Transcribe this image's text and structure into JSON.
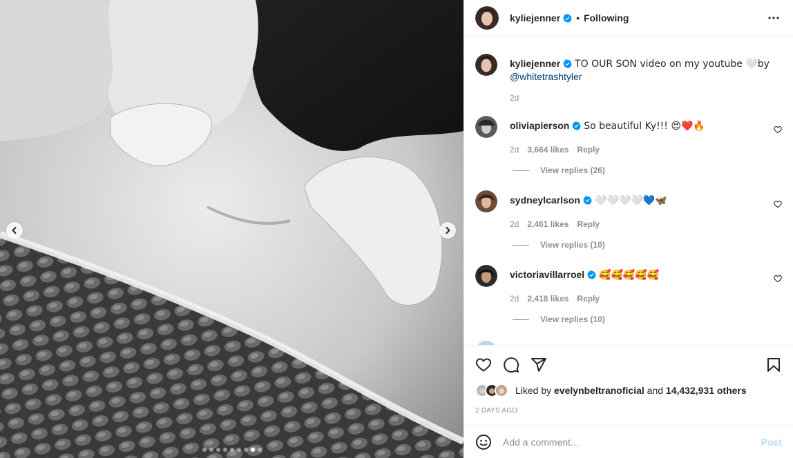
{
  "header": {
    "username": "kyliejenner",
    "separator": "•",
    "following_label": "Following",
    "more_icon": "more-horizontal-icon"
  },
  "caption": {
    "username": "kyliejenner",
    "text": "TO OUR SON video on my youtube 🤍by",
    "mention": "@whitetrashtyler",
    "time": "2d"
  },
  "comments": [
    {
      "username": "oliviapierson",
      "text": "So beautiful Ky!!! 😍❤️🔥",
      "time": "2d",
      "likes": "3,664 likes",
      "reply": "Reply",
      "view_replies": "View replies (26)"
    },
    {
      "username": "sydneylcarlson",
      "text": "🤍🤍🤍🤍💙🦋",
      "time": "2d",
      "likes": "2,461 likes",
      "reply": "Reply",
      "view_replies": "View replies (10)"
    },
    {
      "username": "victoriavillarroel",
      "text": "🥰🥰🥰🥰🥰",
      "time": "2d",
      "likes": "2,418 likes",
      "reply": "Reply",
      "view_replies": "View replies (10)"
    }
  ],
  "likes": {
    "prefix": "Liked by",
    "user": "evelynbeltranoficial",
    "middle": "and",
    "count": "14,432,931 others"
  },
  "timestamp": "2 DAYS AGO",
  "add_comment": {
    "placeholder": "Add a comment...",
    "post_label": "Post"
  },
  "carousel": {
    "total_slides": 9,
    "active_index": 7
  },
  "colors": {
    "verified": "#0095f6",
    "mention": "#00376b",
    "muted": "#8e8e8e",
    "post_disabled": "#b2dffc"
  }
}
